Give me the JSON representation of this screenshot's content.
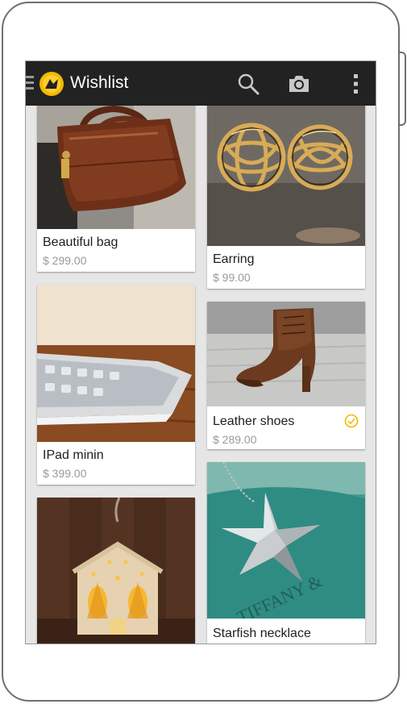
{
  "app": {
    "title": "Wishlist",
    "accent_color": "#f5b800",
    "actionbar_color": "#222222"
  },
  "actions": [
    {
      "name": "search",
      "icon": "search-icon"
    },
    {
      "name": "camera",
      "icon": "camera-icon"
    },
    {
      "name": "overflow",
      "icon": "more-vert-icon"
    }
  ],
  "items": [
    {
      "name": "Beautiful bag",
      "price": "$ 299.00",
      "checked": false
    },
    {
      "name": "Earring",
      "price": "$ 99.00",
      "checked": false
    },
    {
      "name": "IPad minin",
      "price": "$ 399.00",
      "checked": false
    },
    {
      "name": "Leather shoes",
      "price": "$ 289.00",
      "checked": true
    },
    {
      "name": "Starfish  necklace",
      "price": "",
      "checked": false
    },
    {
      "name": "",
      "price": "",
      "checked": false
    }
  ]
}
